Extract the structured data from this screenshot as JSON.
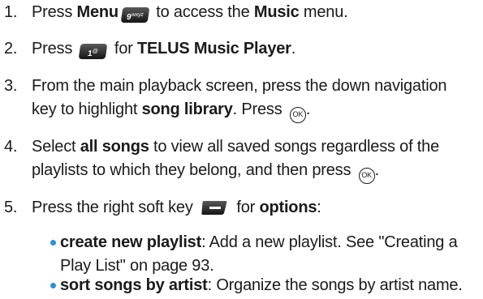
{
  "steps": [
    {
      "num": "1.",
      "pre": "Press ",
      "b1": "Menu",
      "key": "9",
      "keysub": "wxyz",
      "mid": " to access the ",
      "b2": "Music",
      "post": " menu."
    },
    {
      "num": "2.",
      "pre": "Press ",
      "key": "1",
      "keysub": "@",
      "mid": " for ",
      "b1": "TELUS Music Player",
      "post": "."
    },
    {
      "num": "3.",
      "line1": "From the main playback screen, press the down navigation",
      "line2_pre": "key to highlight ",
      "b1": "song library",
      "line2_mid": ". Press ",
      "post": "."
    },
    {
      "num": "4.",
      "line1_pre": "Select ",
      "b1": "all songs",
      "line1_post": " to view all saved songs regardless of the",
      "line2": "playlists to which they belong, and then press ",
      "post": "."
    },
    {
      "num": "5.",
      "pre": "Press the right soft key ",
      "mid": " for ",
      "b1": "options",
      "post": ":"
    }
  ],
  "ok_label": "OK",
  "bullets": [
    {
      "b1": "create new playlist",
      "line1": ": Add a new playlist. See \"Creating a",
      "line2": "Play List\" on page 93."
    },
    {
      "b1": "sort songs by artist",
      "line1": ": Organize the songs by artist name."
    }
  ],
  "colors": {
    "bullet": "#2f8fd3",
    "text": "#1a1a1a",
    "key_bg": "#141414"
  },
  "icons": {
    "menu_key": "key-9-wxyz-icon",
    "key1": "key-1-icon",
    "ok": "ok-button-icon",
    "softkey": "right-soft-key-icon"
  }
}
